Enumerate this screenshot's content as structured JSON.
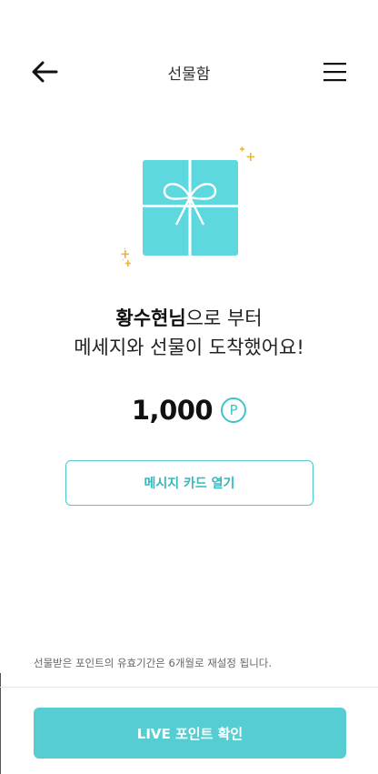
{
  "header": {
    "title": "선물함",
    "back_icon": "arrow-left-icon",
    "menu_icon": "hamburger-menu-icon"
  },
  "gift": {
    "icon": "gift-box-icon",
    "sparkle_icon": "sparkle-icon",
    "box_color": "#5dd8df",
    "sparkle_color": "#f2b233"
  },
  "message": {
    "sender": "황수현님",
    "line1_suffix": "으로 부터",
    "line2": "메세지와 선물이 도착했어요!"
  },
  "points": {
    "value": "1,000",
    "badge": "P",
    "accent_color": "#41c3c8"
  },
  "card_button": {
    "label": "메시지 카드 열기"
  },
  "notice": "선물받은 포인트의 유효기간은 6개월로 재설정 됩니다.",
  "live_button": {
    "label": "LIVE 포인트 확인",
    "color": "#56cdd2"
  }
}
